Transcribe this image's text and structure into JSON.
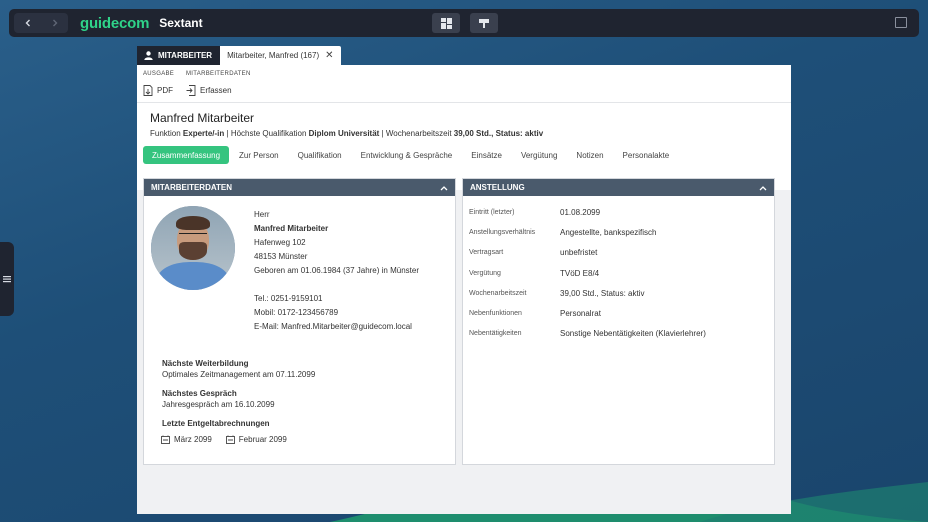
{
  "app": {
    "logo": "guidecom",
    "name": "Sextant"
  },
  "tabs": {
    "module_label": "MITARBEITER",
    "document_label": "Mitarbeiter, Manfred (167)",
    "close_glyph": "✕"
  },
  "toolbar": {
    "group_output": "AUSGABE",
    "group_employee_data": "MITARBEITERDATEN",
    "pdf_label": "PDF",
    "capture_label": "Erfassen"
  },
  "person": {
    "name": "Manfred Mitarbeiter",
    "meta_function_label": "Funktion",
    "meta_function_value": "Experte/-in",
    "meta_qualification_label": "Höchste Qualifikation",
    "meta_qualification_value": "Diplom Universität",
    "meta_hours_label": "Wochenarbeitszeit",
    "meta_hours_value": "39,00 Std., Status: aktiv",
    "separator": "|"
  },
  "nav_tabs": [
    {
      "label": "Zusammenfassung",
      "active": true
    },
    {
      "label": "Zur Person",
      "active": false
    },
    {
      "label": "Qualifikation",
      "active": false
    },
    {
      "label": "Entwicklung & Gespräche",
      "active": false
    },
    {
      "label": "Einsätze",
      "active": false
    },
    {
      "label": "Vergütung",
      "active": false
    },
    {
      "label": "Notizen",
      "active": false
    },
    {
      "label": "Personalakte",
      "active": false
    }
  ],
  "employee_card": {
    "title": "MITARBEITERDATEN",
    "salutation": "Herr",
    "full_name": "Manfred Mitarbeiter",
    "street": "Hafenweg 102",
    "city": "48153 Münster",
    "born": "Geboren am 01.06.1984 (37 Jahre) in Münster",
    "phone": "Tel.: 0251-9159101",
    "mobile": "Mobil: 0172-123456789",
    "email": "E-Mail: Manfred.Mitarbeiter@guidecom.local",
    "next_training_title": "Nächste Weiterbildung",
    "next_training_value": "Optimales Zeitmanagement am 07.11.2099",
    "next_meeting_title": "Nächstes Gespräch",
    "next_meeting_value": "Jahresgespräch am 16.10.2099",
    "payroll_title": "Letzte Entgeltabrechnungen",
    "payroll": [
      "März 2099",
      "Februar 2099"
    ]
  },
  "employment_card": {
    "title": "ANSTELLUNG",
    "rows": [
      {
        "label": "Eintritt (letzter)",
        "value": "01.08.2099"
      },
      {
        "label": "Anstellungsverhältnis",
        "value": "Angestellte, bankspezifisch"
      },
      {
        "label": "Vertragsart",
        "value": "unbefristet"
      },
      {
        "label": "Vergütung",
        "value": "TVöD E8/4"
      },
      {
        "label": "Wochenarbeitszeit",
        "value": "39,00 Std., Status: aktiv"
      },
      {
        "label": "Nebenfunktionen",
        "value": "Personalrat"
      },
      {
        "label": "Nebentätigkeiten",
        "value": "Sonstige Nebentätigkeiten (Klavierlehrer)"
      }
    ]
  },
  "colors": {
    "accent": "#35c47f",
    "logo": "#2fd389",
    "card_header": "#4a5a6c",
    "topbar": "#1f2430"
  }
}
